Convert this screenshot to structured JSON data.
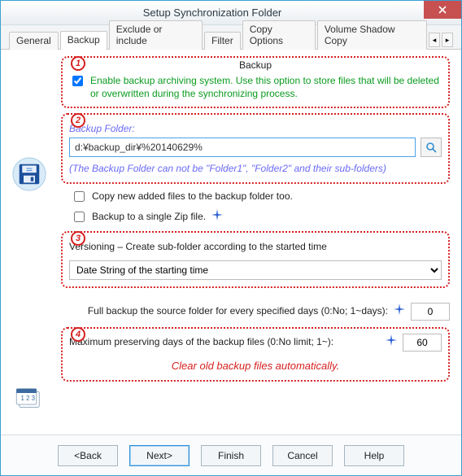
{
  "window": {
    "title": "Setup Synchronization Folder"
  },
  "tabs": {
    "items": [
      "General",
      "Backup",
      "Exclude or include",
      "Filter",
      "Copy Options",
      "Volume Shadow Copy"
    ],
    "active": "Backup"
  },
  "section1": {
    "num": "1",
    "title": "Backup",
    "enable_label": "Enable backup archiving system. Use this option to store files that will be deleted or overwritten during the synchronizing process."
  },
  "section2": {
    "num": "2",
    "header": "Backup Folder:",
    "path": "d:¥backup_dir¥%20140629%",
    "hint": "(The Backup Folder can not be \"Folder1\", \"Folder2\" and their sub-folders)"
  },
  "copy_new_label": "Copy new added files to the backup folder too.",
  "zip_label": "Backup to a single Zip file.",
  "section3": {
    "num": "3",
    "title": "Versioning – Create sub-folder according to the started time",
    "select_value": "Date String of the starting time"
  },
  "fullbk": {
    "label": "Full backup the source folder for every specified days (0:No; 1~days):",
    "value": "0"
  },
  "section4": {
    "num": "4",
    "label": "Maximum preserving days of the backup files (0:No limit; 1~):",
    "value": "60",
    "note": "Clear old backup files automatically."
  },
  "footer": {
    "back": "<Back",
    "next": "Next>",
    "finish": "Finish",
    "cancel": "Cancel",
    "help": "Help"
  }
}
